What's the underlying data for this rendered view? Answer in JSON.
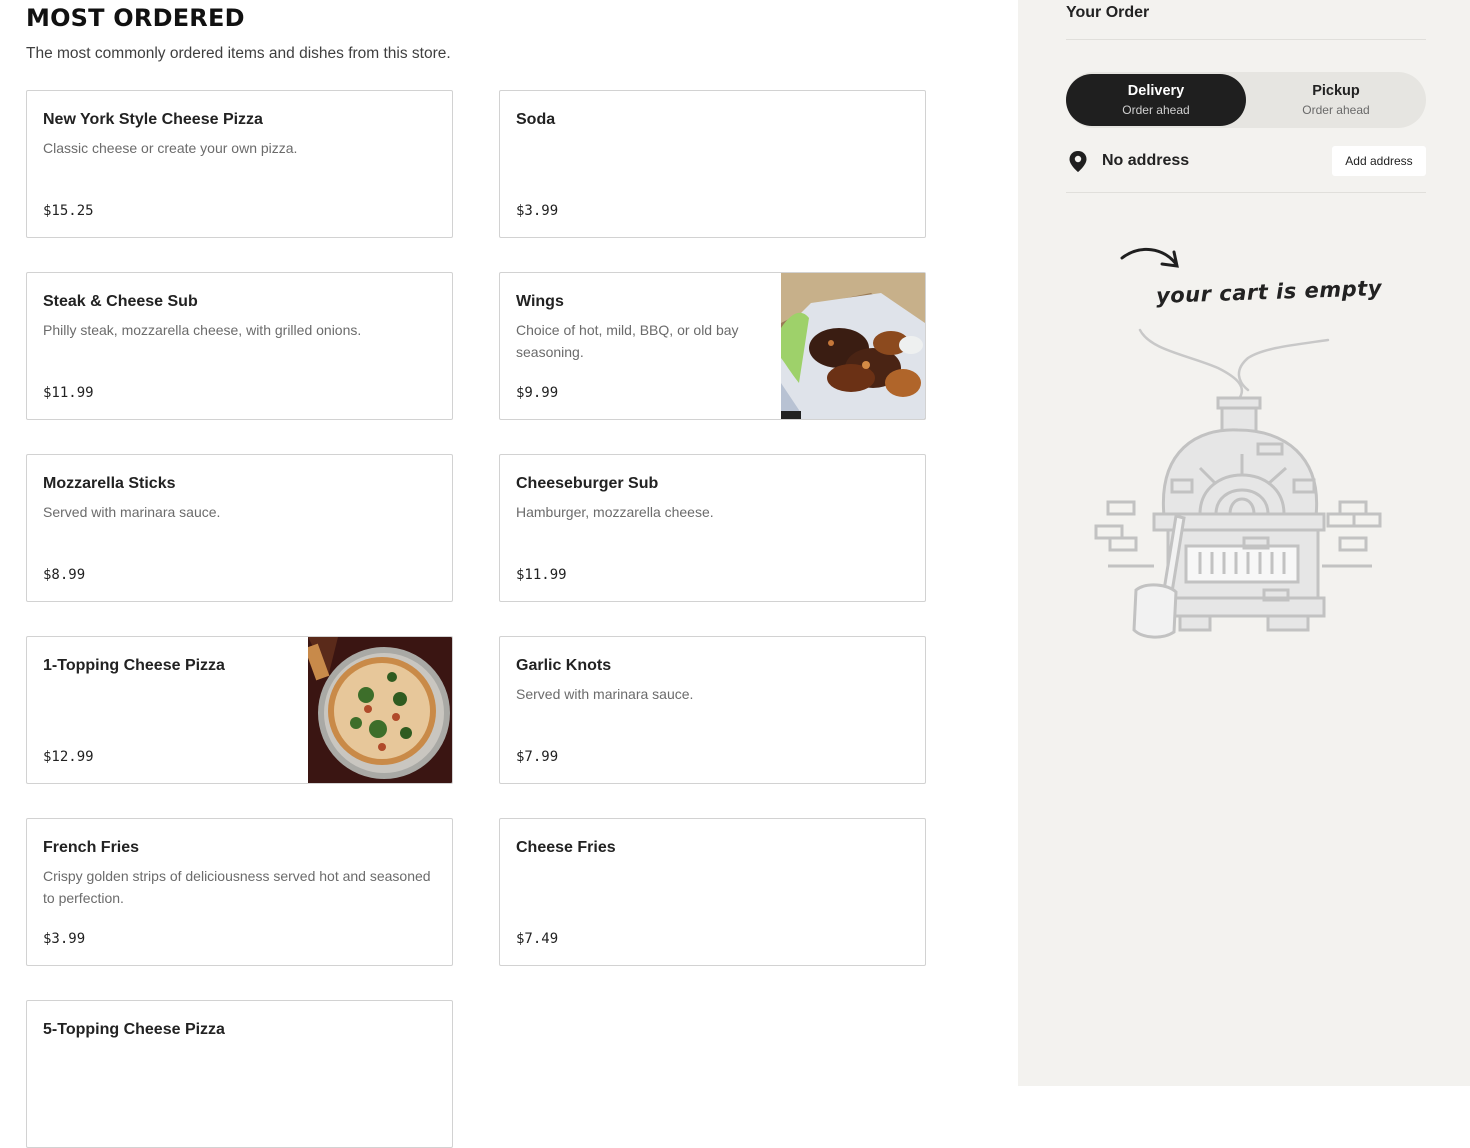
{
  "main": {
    "title": "MOST ORDERED",
    "subtitle": "The most commonly ordered items and dishes from this store.",
    "items": [
      {
        "name": "New York Style Cheese Pizza",
        "desc": "Classic cheese or create your own pizza.",
        "price": "$15.25"
      },
      {
        "name": "Soda",
        "desc": "",
        "price": "$3.99"
      },
      {
        "name": "Steak & Cheese Sub",
        "desc": "Philly steak, mozzarella cheese, with grilled onions.",
        "price": "$11.99"
      },
      {
        "name": "Wings",
        "desc": "Choice of hot, mild, BBQ, or old bay seasoning.",
        "price": "$9.99"
      },
      {
        "name": "Mozzarella Sticks",
        "desc": "Served with marinara sauce.",
        "price": "$8.99"
      },
      {
        "name": "Cheeseburger Sub",
        "desc": "Hamburger, mozzarella cheese.",
        "price": "$11.99"
      },
      {
        "name": "1-Topping Cheese Pizza",
        "desc": "",
        "price": "$12.99"
      },
      {
        "name": "Garlic Knots",
        "desc": "Served with marinara sauce.",
        "price": "$7.99"
      },
      {
        "name": "French Fries",
        "desc": "Crispy golden strips of deliciousness served hot and seasoned to perfection.",
        "price": "$3.99"
      },
      {
        "name": "Cheese Fries",
        "desc": "",
        "price": "$7.49"
      },
      {
        "name": "5-Topping Cheese Pizza",
        "desc": "",
        "price": ""
      }
    ]
  },
  "sidebar": {
    "title": "Your Order",
    "delivery": {
      "label": "Delivery",
      "sub": "Order ahead"
    },
    "pickup": {
      "label": "Pickup",
      "sub": "Order ahead"
    },
    "address": {
      "text": "No address",
      "button": "Add address"
    },
    "empty_text": "your cart is empty"
  },
  "icons": {
    "location": "location-pin-icon",
    "arrow": "curved-arrow-icon"
  },
  "colors": {
    "accent": "#1f1f1f",
    "sidebar_bg": "#f3f2ef",
    "card_border": "#d2d2d2"
  }
}
